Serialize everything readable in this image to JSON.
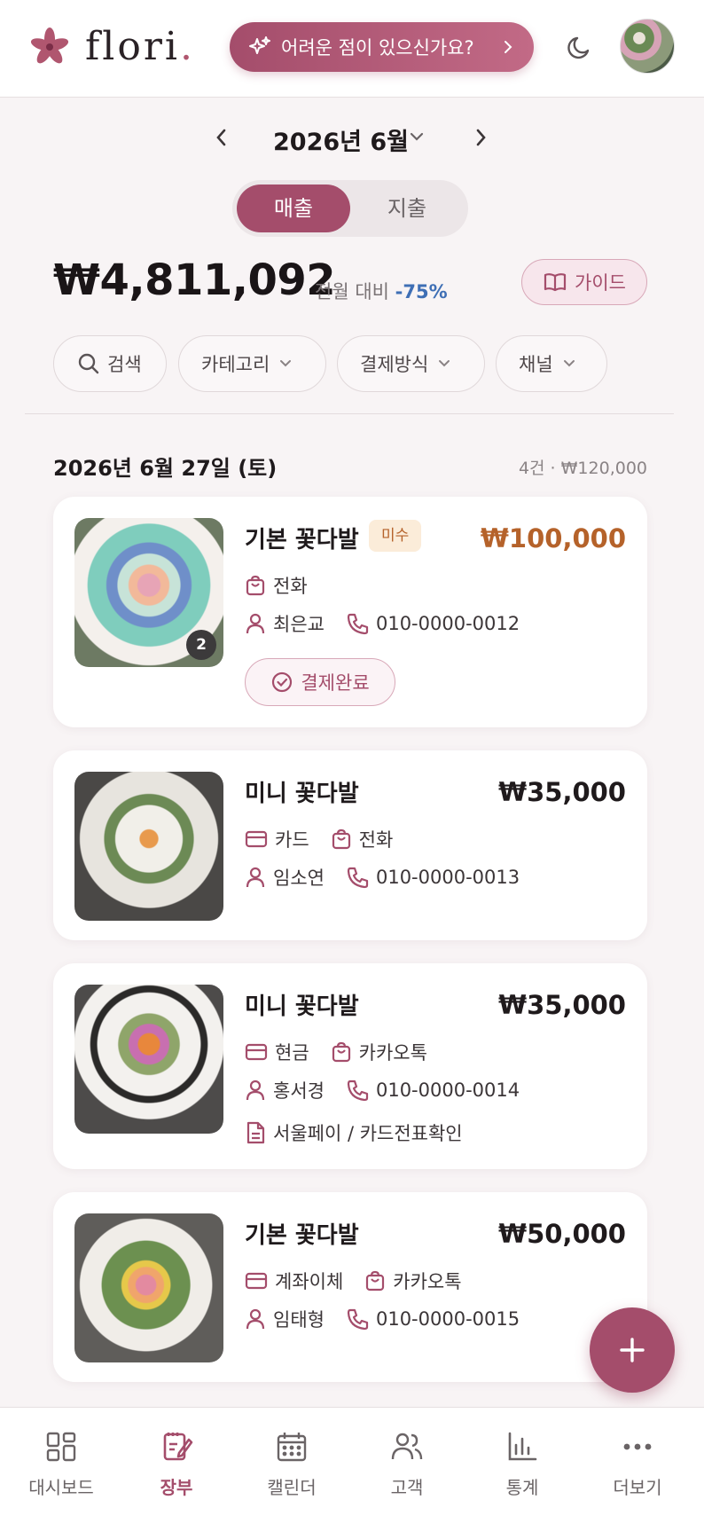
{
  "app": {
    "logo_text": "flori",
    "logo_dot": "."
  },
  "header": {
    "help_label": "어려운 점이 있으신가요?"
  },
  "month_nav": {
    "label": "2026년 6월"
  },
  "toggle": {
    "active": "매출",
    "inactive": "지출"
  },
  "summary": {
    "total": "₩4,811,092",
    "compare_label": "전월 대비",
    "compare_pct": "-75%",
    "guide_label": "가이드"
  },
  "filters": {
    "search": "검색",
    "category": "카테고리",
    "payment": "결제방식",
    "channel": "채널"
  },
  "day": {
    "date": "2026년 6월 27일 (토)",
    "summary": "4건 · ₩120,000"
  },
  "orders": [
    {
      "title": "기본 꽃다발",
      "tag": "미수",
      "price": "₩100,000",
      "channel": "전화",
      "customer": "최은교",
      "phone": "010-0000-0012",
      "badge": "2",
      "status": "결제완료"
    },
    {
      "title": "미니 꽃다발",
      "price": "₩35,000",
      "payment": "카드",
      "channel": "전화",
      "customer": "임소연",
      "phone": "010-0000-0013"
    },
    {
      "title": "미니 꽃다발",
      "price": "₩35,000",
      "payment": "현금",
      "channel": "카카오톡",
      "customer": "홍서경",
      "phone": "010-0000-0014",
      "memo": "서울페이 / 카드전표확인"
    },
    {
      "title": "기본 꽃다발",
      "price": "₩50,000",
      "payment": "계좌이체",
      "channel": "카카오톡",
      "customer": "임태형",
      "phone": "010-0000-0015"
    }
  ],
  "nav": [
    {
      "label": "대시보드",
      "icon": "grid-icon"
    },
    {
      "label": "장부",
      "icon": "ledger-icon"
    },
    {
      "label": "캘린더",
      "icon": "calendar-icon"
    },
    {
      "label": "고객",
      "icon": "users-icon"
    },
    {
      "label": "통계",
      "icon": "chart-icon"
    },
    {
      "label": "더보기",
      "icon": "more-icon"
    }
  ],
  "colors": {
    "primary": "#a44d6b",
    "accent_blue": "#3f6fb5",
    "unpaid": "#b5622a",
    "background": "#f8f4f5"
  }
}
